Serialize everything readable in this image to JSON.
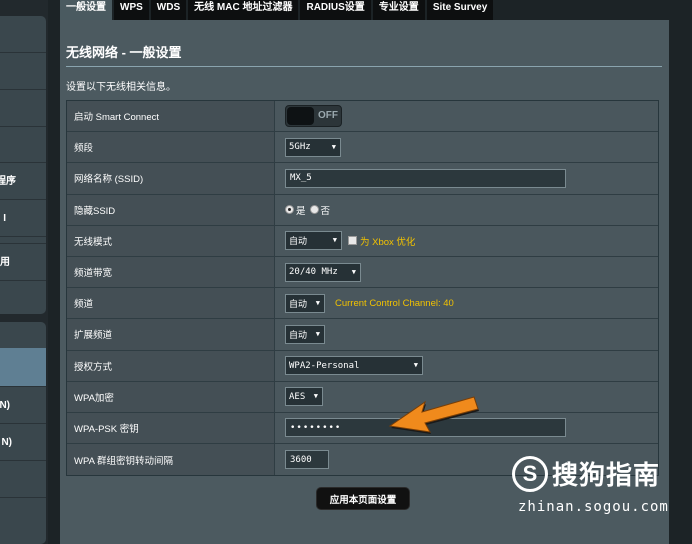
{
  "tabs": [
    {
      "label": "一般设置",
      "active": true
    },
    {
      "label": "WPS"
    },
    {
      "label": "WDS"
    },
    {
      "label": "无线 MAC 地址过滤器"
    },
    {
      "label": "RADIUS设置"
    },
    {
      "label": "专业设置"
    },
    {
      "label": "Site Survey"
    }
  ],
  "sidebar": {
    "items": [
      {
        "label": "程序"
      },
      {
        "label": "I"
      },
      {
        "label": "用"
      },
      {
        "label": "N)"
      },
      {
        "label": "N)"
      }
    ]
  },
  "panel": {
    "title": "无线网络 - 一般设置",
    "description": "设置以下无线相关信息。"
  },
  "settings": {
    "smart_connect": {
      "label": "启动 Smart Connect",
      "state": "OFF"
    },
    "band": {
      "label": "频段",
      "value": "5GHz"
    },
    "ssid": {
      "label": "网络名称 (SSID)",
      "value": "MX_5"
    },
    "hide_ssid": {
      "label": "隐藏SSID",
      "option_yes": "是",
      "option_no": "否",
      "selected": "yes"
    },
    "wireless_mode": {
      "label": "无线模式",
      "value": "自动",
      "xbox_label": "为 Xbox 优化"
    },
    "channel_width": {
      "label": "频道带宽",
      "value": "20/40 MHz"
    },
    "channel": {
      "label": "频道",
      "value": "自动",
      "info": "Current Control Channel: 40"
    },
    "ext_channel": {
      "label": "扩展频道",
      "value": "自动"
    },
    "auth_method": {
      "label": "授权方式",
      "value": "WPA2-Personal"
    },
    "wpa_encryption": {
      "label": "WPA加密",
      "value": "AES"
    },
    "wpa_psk": {
      "label": "WPA-PSK 密钥",
      "value": "••••••••"
    },
    "group_key_interval": {
      "label": "WPA 群组密钥转动间隔",
      "value": "3600"
    }
  },
  "apply_button": "应用本页面设置",
  "watermark": {
    "logo_letter": "S",
    "brand": "搜狗指南",
    "url": "zhinan.sogou.com"
  },
  "colors": {
    "panel": "#4c5a60",
    "accent_yellow": "#f2c200",
    "arrow_orange": "#f08a1c"
  }
}
